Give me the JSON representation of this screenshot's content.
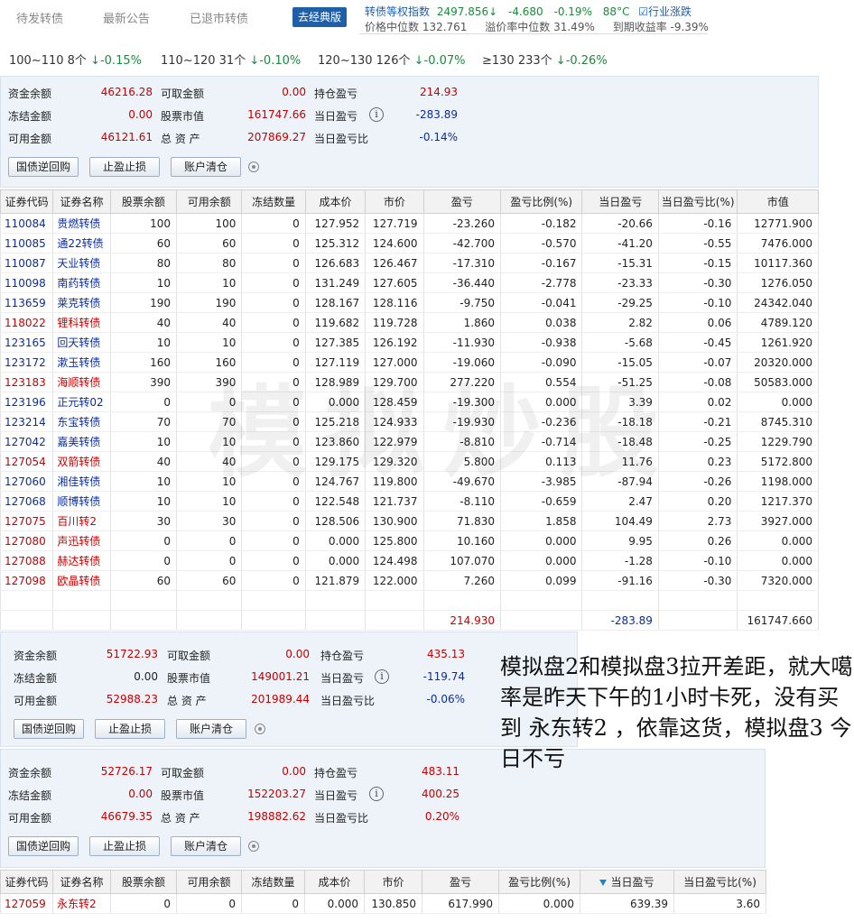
{
  "tabs": [
    "待发转债",
    "最新公告",
    "已退市转债"
  ],
  "classic_button": "去经典版",
  "index": {
    "name": "转债等权指数",
    "value": "2497.856",
    "arrow": "↓",
    "change": "-4.680",
    "change_pct": "-0.19%",
    "temperature": "88°C",
    "industry_link": "行业涨跌",
    "median_price": "价格中位数 132.761",
    "premium_median": "溢价率中位数 31.49%",
    "ytm": "到期收益率 -9.39%"
  },
  "ranges": [
    {
      "label": "100~110 8个",
      "value": "↓-0.15%"
    },
    {
      "label": "110~120 31个",
      "value": "↓-0.10%"
    },
    {
      "label": "120~130 126个",
      "value": "↓-0.07%"
    },
    {
      "label": "≥130 233个",
      "value": "↓-0.26%"
    }
  ],
  "accounts": [
    {
      "cash_balance_label": "资金余额",
      "cash_balance": "46216.28",
      "withdrawable_label": "可取金额",
      "withdrawable": "0.00",
      "holding_pl_label": "持仓盈亏",
      "holding_pl": "214.93",
      "frozen_label": "冻结金额",
      "frozen": "0.00",
      "stock_value_label": "股票市值",
      "stock_value": "161747.66",
      "today_pl_label": "当日盈亏",
      "today_pl": "-283.89",
      "available_label": "可用金额",
      "available": "46121.61",
      "total_assets_label": "总 资 产",
      "total_assets": "207869.27",
      "today_pl_ratio_label": "当日盈亏比",
      "today_pl_ratio": "-0.14%",
      "btn_repo": "国债逆回购",
      "btn_stop": "止盈止损",
      "btn_clear": "账户清仓"
    },
    {
      "cash_balance_label": "资金余额",
      "cash_balance": "51722.93",
      "withdrawable_label": "可取金额",
      "withdrawable": "0.00",
      "holding_pl_label": "持仓盈亏",
      "holding_pl": "435.13",
      "frozen_label": "冻结金额",
      "frozen": "0.00",
      "stock_value_label": "股票市值",
      "stock_value": "149001.21",
      "today_pl_label": "当日盈亏",
      "today_pl": "-119.74",
      "available_label": "可用金额",
      "available": "52988.23",
      "total_assets_label": "总 资 产",
      "total_assets": "201989.44",
      "today_pl_ratio_label": "当日盈亏比",
      "today_pl_ratio": "-0.06%",
      "btn_repo": "国债逆回购",
      "btn_stop": "止盈止损",
      "btn_clear": "账户清仓"
    },
    {
      "cash_balance_label": "资金余额",
      "cash_balance": "52726.17",
      "withdrawable_label": "可取金额",
      "withdrawable": "0.00",
      "holding_pl_label": "持仓盈亏",
      "holding_pl": "483.11",
      "frozen_label": "冻结金额",
      "frozen": "0.00",
      "stock_value_label": "股票市值",
      "stock_value": "152203.27",
      "today_pl_label": "当日盈亏",
      "today_pl": "400.25",
      "available_label": "可用金额",
      "available": "46679.35",
      "total_assets_label": "总 资 产",
      "total_assets": "198882.62",
      "today_pl_ratio_label": "当日盈亏比",
      "today_pl_ratio": "0.20%",
      "btn_repo": "国债逆回购",
      "btn_stop": "止盈止损",
      "btn_clear": "账户清仓"
    }
  ],
  "holdings_headers": [
    "证券代码",
    "证券名称",
    "股票余额",
    "可用余额",
    "冻结数量",
    "成本价",
    "市价",
    "盈亏",
    "盈亏比例(%)",
    "当日盈亏",
    "当日盈亏比(%)",
    "市值"
  ],
  "holdings": [
    [
      "110084",
      "贵燃转债",
      "100",
      "100",
      "0",
      "127.952",
      "127.719",
      "-23.260",
      "-0.182",
      "-20.66",
      "-0.16",
      "12771.900",
      "neg"
    ],
    [
      "110085",
      "通22转债",
      "60",
      "60",
      "0",
      "125.312",
      "124.600",
      "-42.700",
      "-0.570",
      "-41.20",
      "-0.55",
      "7476.000",
      "neg"
    ],
    [
      "110087",
      "天业转债",
      "80",
      "80",
      "0",
      "126.683",
      "126.467",
      "-17.310",
      "-0.167",
      "-15.31",
      "-0.15",
      "10117.360",
      "neg"
    ],
    [
      "110098",
      "南药转债",
      "10",
      "10",
      "0",
      "131.249",
      "127.605",
      "-36.440",
      "-2.778",
      "-23.33",
      "-0.30",
      "1276.050",
      "neg"
    ],
    [
      "113659",
      "莱克转债",
      "190",
      "190",
      "0",
      "128.167",
      "128.116",
      "-9.750",
      "-0.041",
      "-29.25",
      "-0.10",
      "24342.040",
      "neg"
    ],
    [
      "118022",
      "锂科转债",
      "40",
      "40",
      "0",
      "119.682",
      "119.728",
      "1.860",
      "0.038",
      "2.82",
      "0.06",
      "4789.120",
      "pos"
    ],
    [
      "123165",
      "回天转债",
      "10",
      "10",
      "0",
      "127.385",
      "126.192",
      "-11.930",
      "-0.938",
      "-5.68",
      "-0.45",
      "1261.920",
      "neg"
    ],
    [
      "123172",
      "漱玉转债",
      "160",
      "160",
      "0",
      "127.119",
      "127.000",
      "-19.060",
      "-0.090",
      "-15.05",
      "-0.07",
      "20320.000",
      "neg"
    ],
    [
      "123183",
      "海顺转债",
      "390",
      "390",
      "0",
      "128.989",
      "129.700",
      "277.220",
      "0.554",
      "-51.25",
      "-0.08",
      "50583.000",
      "pos"
    ],
    [
      "123196",
      "正元转02",
      "0",
      "0",
      "0",
      "0.000",
      "128.459",
      "-19.300",
      "0.000",
      "3.39",
      "0.02",
      "0.000",
      "neg"
    ],
    [
      "123214",
      "东宝转债",
      "70",
      "70",
      "0",
      "125.218",
      "124.933",
      "-19.930",
      "-0.236",
      "-18.18",
      "-0.21",
      "8745.310",
      "neg"
    ],
    [
      "127042",
      "嘉美转债",
      "10",
      "10",
      "0",
      "123.860",
      "122.979",
      "-8.810",
      "-0.714",
      "-18.48",
      "-0.25",
      "1229.790",
      "neg"
    ],
    [
      "127054",
      "双箭转债",
      "40",
      "40",
      "0",
      "129.175",
      "129.320",
      "5.800",
      "0.113",
      "11.76",
      "0.23",
      "5172.800",
      "pos"
    ],
    [
      "127060",
      "湘佳转债",
      "10",
      "10",
      "0",
      "124.767",
      "119.800",
      "-49.670",
      "-3.985",
      "-87.94",
      "-0.26",
      "1198.000",
      "neg"
    ],
    [
      "127068",
      "顺博转债",
      "10",
      "10",
      "0",
      "122.548",
      "121.737",
      "-8.110",
      "-0.659",
      "2.47",
      "0.20",
      "1217.370",
      "neg"
    ],
    [
      "127075",
      "百川转2",
      "30",
      "30",
      "0",
      "128.506",
      "130.900",
      "71.830",
      "1.858",
      "104.49",
      "2.73",
      "3927.000",
      "pos"
    ],
    [
      "127080",
      "声迅转债",
      "0",
      "0",
      "0",
      "0.000",
      "125.800",
      "10.160",
      "0.000",
      "9.95",
      "0.26",
      "0.000",
      "pos"
    ],
    [
      "127088",
      "赫达转债",
      "0",
      "0",
      "0",
      "0.000",
      "124.498",
      "107.070",
      "0.000",
      "-1.28",
      "-0.10",
      "0.000",
      "pos"
    ],
    [
      "127098",
      "欧晶转债",
      "60",
      "60",
      "0",
      "121.879",
      "122.000",
      "7.260",
      "0.099",
      "-91.16",
      "-0.30",
      "7320.000",
      "pos"
    ]
  ],
  "holdings_total": {
    "pl": "214.930",
    "today_pl": "-283.89",
    "market_value": "161747.660"
  },
  "holdings3_headers": [
    "证券代码",
    "证券名称",
    "股票余额",
    "可用余额",
    "冻结数量",
    "成本价",
    "市价",
    "盈亏",
    "盈亏比例(%)",
    "当日盈亏",
    "当日盈亏比(%)"
  ],
  "holdings3": [
    [
      "127059",
      "永东转2",
      "0",
      "0",
      "0",
      "0.000",
      "130.850",
      "617.990",
      "0.000",
      "639.39",
      "3.60",
      "pos"
    ]
  ],
  "watermark": "模拟炒股",
  "note": "模拟盘2和模拟盘3拉开差距，就大噶率是昨天下午的1小时卡死，没有买到 永东转2 ，依靠这货，模拟盘3 今日不亏"
}
